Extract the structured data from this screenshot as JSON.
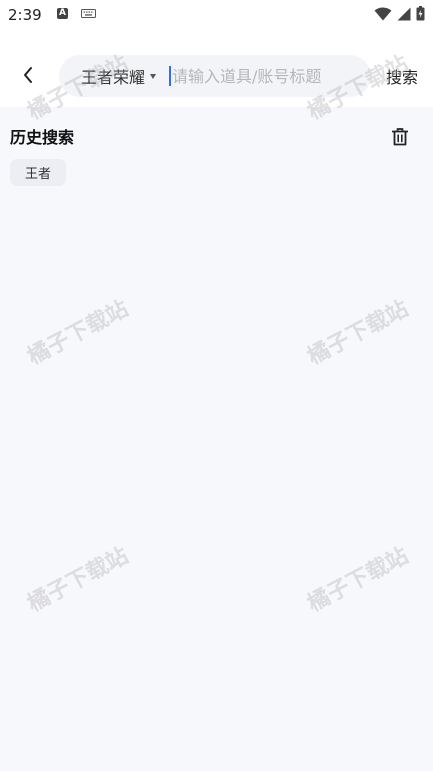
{
  "status_bar": {
    "time": "2:39",
    "notification_icon_letter": "A"
  },
  "header": {
    "game_selector": "王者荣耀",
    "search_placeholder": "请输入道具/账号标题",
    "search_button": "搜索"
  },
  "history": {
    "title": "历史搜索",
    "items": [
      "王者"
    ]
  },
  "watermark": "橘子下载站",
  "colors": {
    "page_background": "#f7f8fc",
    "caret_accent": "#2f6bff"
  }
}
